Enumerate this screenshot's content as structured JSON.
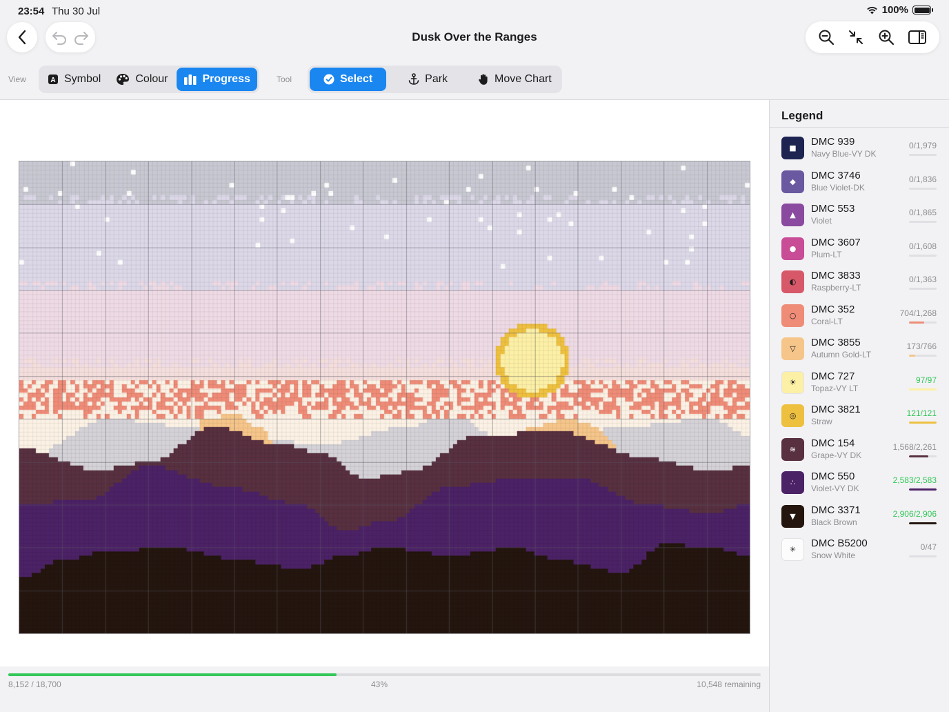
{
  "status": {
    "time": "23:54",
    "date": "Thu 30 Jul",
    "battery": "100%"
  },
  "header": {
    "title": "Dusk Over the Ranges"
  },
  "toolbar": {
    "view_label": "View",
    "tool_label": "Tool",
    "views": [
      {
        "label": "Symbol",
        "icon": "symbol-icon",
        "active": false
      },
      {
        "label": "Colour",
        "icon": "palette-icon",
        "active": false
      },
      {
        "label": "Progress",
        "icon": "bar-chart-icon",
        "active": true
      }
    ],
    "tools": [
      {
        "label": "Select",
        "icon": "checkmark-circle-icon",
        "active": true
      },
      {
        "label": "Park",
        "icon": "anchor-icon",
        "active": false
      },
      {
        "label": "Move Chart",
        "icon": "hand-icon",
        "active": false
      }
    ]
  },
  "progress": {
    "done_text": "8,152 / 18,700",
    "percent_text": "43%",
    "remaining_text": "10,548 remaining",
    "fraction": 0.436,
    "color": "#34c759"
  },
  "legend": {
    "title": "Legend",
    "items": [
      {
        "name": "DMC 939",
        "desc": "Navy Blue-VY DK",
        "count": "0/1,979",
        "color": "#1d2452",
        "symbol": "■",
        "sym_color": "#ffffff",
        "fraction": 0
      },
      {
        "name": "DMC 3746",
        "desc": "Blue Violet-DK",
        "count": "0/1,836",
        "color": "#6a58a0",
        "symbol": "◆",
        "sym_color": "#ffffff",
        "fraction": 0
      },
      {
        "name": "DMC 553",
        "desc": "Violet",
        "count": "0/1,865",
        "color": "#8a4aa0",
        "symbol": "▲",
        "sym_color": "#ffffff",
        "fraction": 0
      },
      {
        "name": "DMC 3607",
        "desc": "Plum-LT",
        "count": "0/1,608",
        "color": "#c84c96",
        "symbol": "●",
        "sym_color": "#ffffff",
        "fraction": 0
      },
      {
        "name": "DMC 3833",
        "desc": "Raspberry-LT",
        "count": "0/1,363",
        "color": "#d75868",
        "symbol": "◐",
        "sym_color": "#1c1c1e",
        "fraction": 0
      },
      {
        "name": "DMC 352",
        "desc": "Coral-LT",
        "count": "704/1,268",
        "color": "#ee8c78",
        "symbol": "○",
        "sym_color": "#1c1c1e",
        "fraction": 0.555
      },
      {
        "name": "DMC 3855",
        "desc": "Autumn Gold-LT",
        "count": "173/766",
        "color": "#f5c58a",
        "symbol": "▽",
        "sym_color": "#1c1c1e",
        "fraction": 0.226
      },
      {
        "name": "DMC 727",
        "desc": "Topaz-VY LT",
        "count": "97/97",
        "color": "#fcefa6",
        "symbol": "☀",
        "sym_color": "#1c1c1e",
        "fraction": 1.0,
        "done": true
      },
      {
        "name": "DMC 3821",
        "desc": "Straw",
        "count": "121/121",
        "color": "#eec040",
        "symbol": "◎",
        "sym_color": "#1c1c1e",
        "fraction": 1.0,
        "done": true
      },
      {
        "name": "DMC 154",
        "desc": "Grape-VY DK",
        "count": "1,568/2,261",
        "color": "#583040",
        "symbol": "≋",
        "sym_color": "#ffffff",
        "fraction": 0.693
      },
      {
        "name": "DMC 550",
        "desc": "Violet-VY DK",
        "count": "2,583/2,583",
        "color": "#4c2266",
        "symbol": "∴",
        "sym_color": "#ffffff",
        "fraction": 1.0,
        "done": true
      },
      {
        "name": "DMC 3371",
        "desc": "Black Brown",
        "count": "2,906/2,906",
        "color": "#24160f",
        "symbol": "▼",
        "sym_color": "#ffffff",
        "fraction": 1.0,
        "done": true
      },
      {
        "name": "DMC B5200",
        "desc": "Snow White",
        "count": "0/47",
        "color": "#fcfcfc",
        "symbol": "✳",
        "sym_color": "#1c1c1e",
        "fraction": 0
      }
    ]
  },
  "chart_colors": {
    "sky_top": "#c8c8d2",
    "sky_lavender": "#dcd8e8",
    "sky_pink": "#eedae4",
    "sky_blush": "#f4dedc",
    "cream": "#fbf1e4",
    "coral": "#ee8c78",
    "gold": "#f5c58a",
    "sun": "#fcefa6",
    "sun_ring": "#eec040",
    "grey_mtn": "#d4d2d6",
    "grape": "#583040",
    "violet": "#4c2266",
    "brown": "#24160f",
    "star": "#fcfcfc"
  }
}
